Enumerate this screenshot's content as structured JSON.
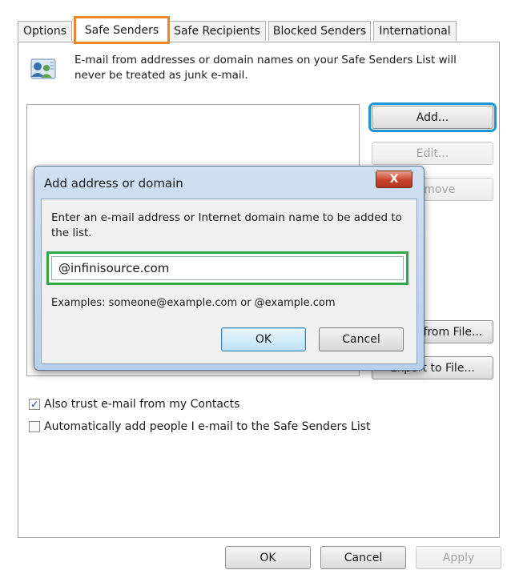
{
  "tabs": [
    {
      "label": "Options"
    },
    {
      "label": "Safe Senders"
    },
    {
      "label": "Safe Recipients"
    },
    {
      "label": "Blocked Senders"
    },
    {
      "label": "International"
    }
  ],
  "info": {
    "text": "E-mail from addresses or domain names on your Safe Senders List will never be treated as junk e-mail.",
    "icon": "contacts-icon"
  },
  "side_buttons": {
    "add": "Add...",
    "edit": "Edit...",
    "remove": "Remove",
    "import": "Import from File...",
    "export": "Export to File..."
  },
  "checkboxes": [
    {
      "label": "Also trust e-mail from my Contacts",
      "checked": true
    },
    {
      "label": "Automatically add people I e-mail to the Safe Senders List",
      "checked": false
    }
  ],
  "footer": {
    "ok": "OK",
    "cancel": "Cancel",
    "apply": "Apply"
  },
  "dialog": {
    "title": "Add address or domain",
    "close": "X",
    "prompt": "Enter an e-mail address or Internet domain name to be added to the list.",
    "input_value": "@infinisource.com",
    "examples": "Examples: someone@example.com or @example.com",
    "ok": "OK",
    "cancel": "Cancel"
  },
  "colors": {
    "tab_highlight": "#e8862a",
    "add_highlight": "#1c95d6",
    "input_highlight": "#2fa84a"
  }
}
